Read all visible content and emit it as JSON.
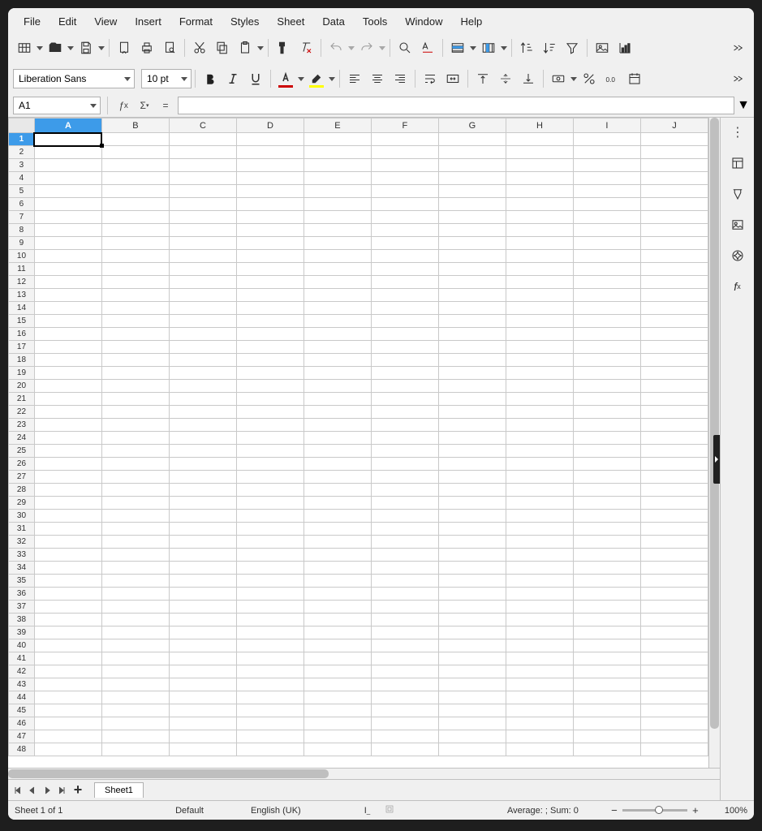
{
  "menu": {
    "items": [
      "File",
      "Edit",
      "View",
      "Insert",
      "Format",
      "Styles",
      "Sheet",
      "Data",
      "Tools",
      "Window",
      "Help"
    ]
  },
  "font": {
    "name": "Liberation Sans",
    "size": "10 pt"
  },
  "namebox": {
    "value": "A1"
  },
  "formula": {
    "value": ""
  },
  "columns": [
    "A",
    "B",
    "C",
    "D",
    "E",
    "F",
    "G",
    "H",
    "I",
    "J"
  ],
  "rows_count": 48,
  "selected": {
    "col": "A",
    "row": 1
  },
  "tabs": {
    "sheet": "Sheet1"
  },
  "status": {
    "sheet_info": "Sheet 1 of 1",
    "style": "Default",
    "lang": "English (UK)",
    "aggregate": "Average: ; Sum: 0",
    "zoom": "100%"
  },
  "formula_bar_icons": {
    "fx": "ƒ",
    "fx_sub": "x",
    "sigma": "Σ",
    "eq": "="
  }
}
